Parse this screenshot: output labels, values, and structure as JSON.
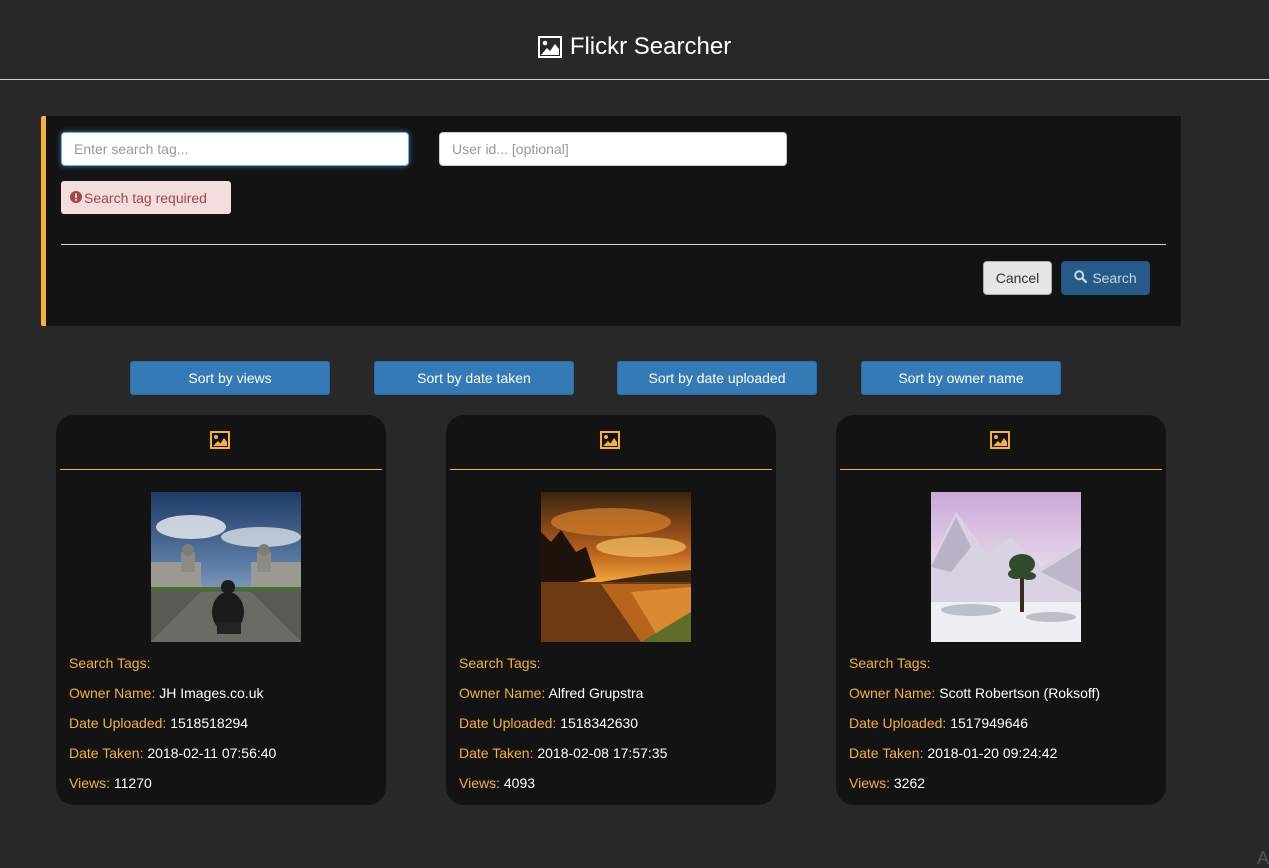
{
  "header": {
    "title": "Flickr Searcher",
    "icon": "image-icon"
  },
  "search": {
    "tag_placeholder": "Enter search tag...",
    "tag_value": "",
    "user_placeholder": "User id... [optional]",
    "user_value": "",
    "error_text": "Search tag required",
    "cancel_label": "Cancel",
    "search_label": "Search"
  },
  "sort": {
    "views": "Sort by views",
    "date_taken": "Sort by date taken",
    "date_uploaded": "Sort by date uploaded",
    "owner_name": "Sort by owner name"
  },
  "labels": {
    "search_tags": "Search Tags:",
    "owner_name": "Owner Name:",
    "date_uploaded": "Date Uploaded:",
    "date_taken": "Date Taken:",
    "views": "Views:"
  },
  "photos": [
    {
      "search_tags": "",
      "owner_name": "JH Images.co.uk",
      "date_uploaded": "1518518294",
      "date_taken": "2018-02-11 07:56:40",
      "views": "11270"
    },
    {
      "search_tags": "",
      "owner_name": "Alfred Grupstra",
      "date_uploaded": "1518342630",
      "date_taken": "2018-02-08 17:57:35",
      "views": "4093"
    },
    {
      "search_tags": "",
      "owner_name": "Scott Robertson (Roksoff)",
      "date_uploaded": "1517949646",
      "date_taken": "2018-01-20 09:24:42",
      "views": "3262"
    }
  ],
  "corner": "A",
  "colors": {
    "background": "#282828",
    "panel": "#131313",
    "accent": "#f5b23a",
    "primary": "#337ab7",
    "search_button": "#265a88",
    "alert_bg": "#f2dede",
    "alert_text": "#a94442"
  }
}
